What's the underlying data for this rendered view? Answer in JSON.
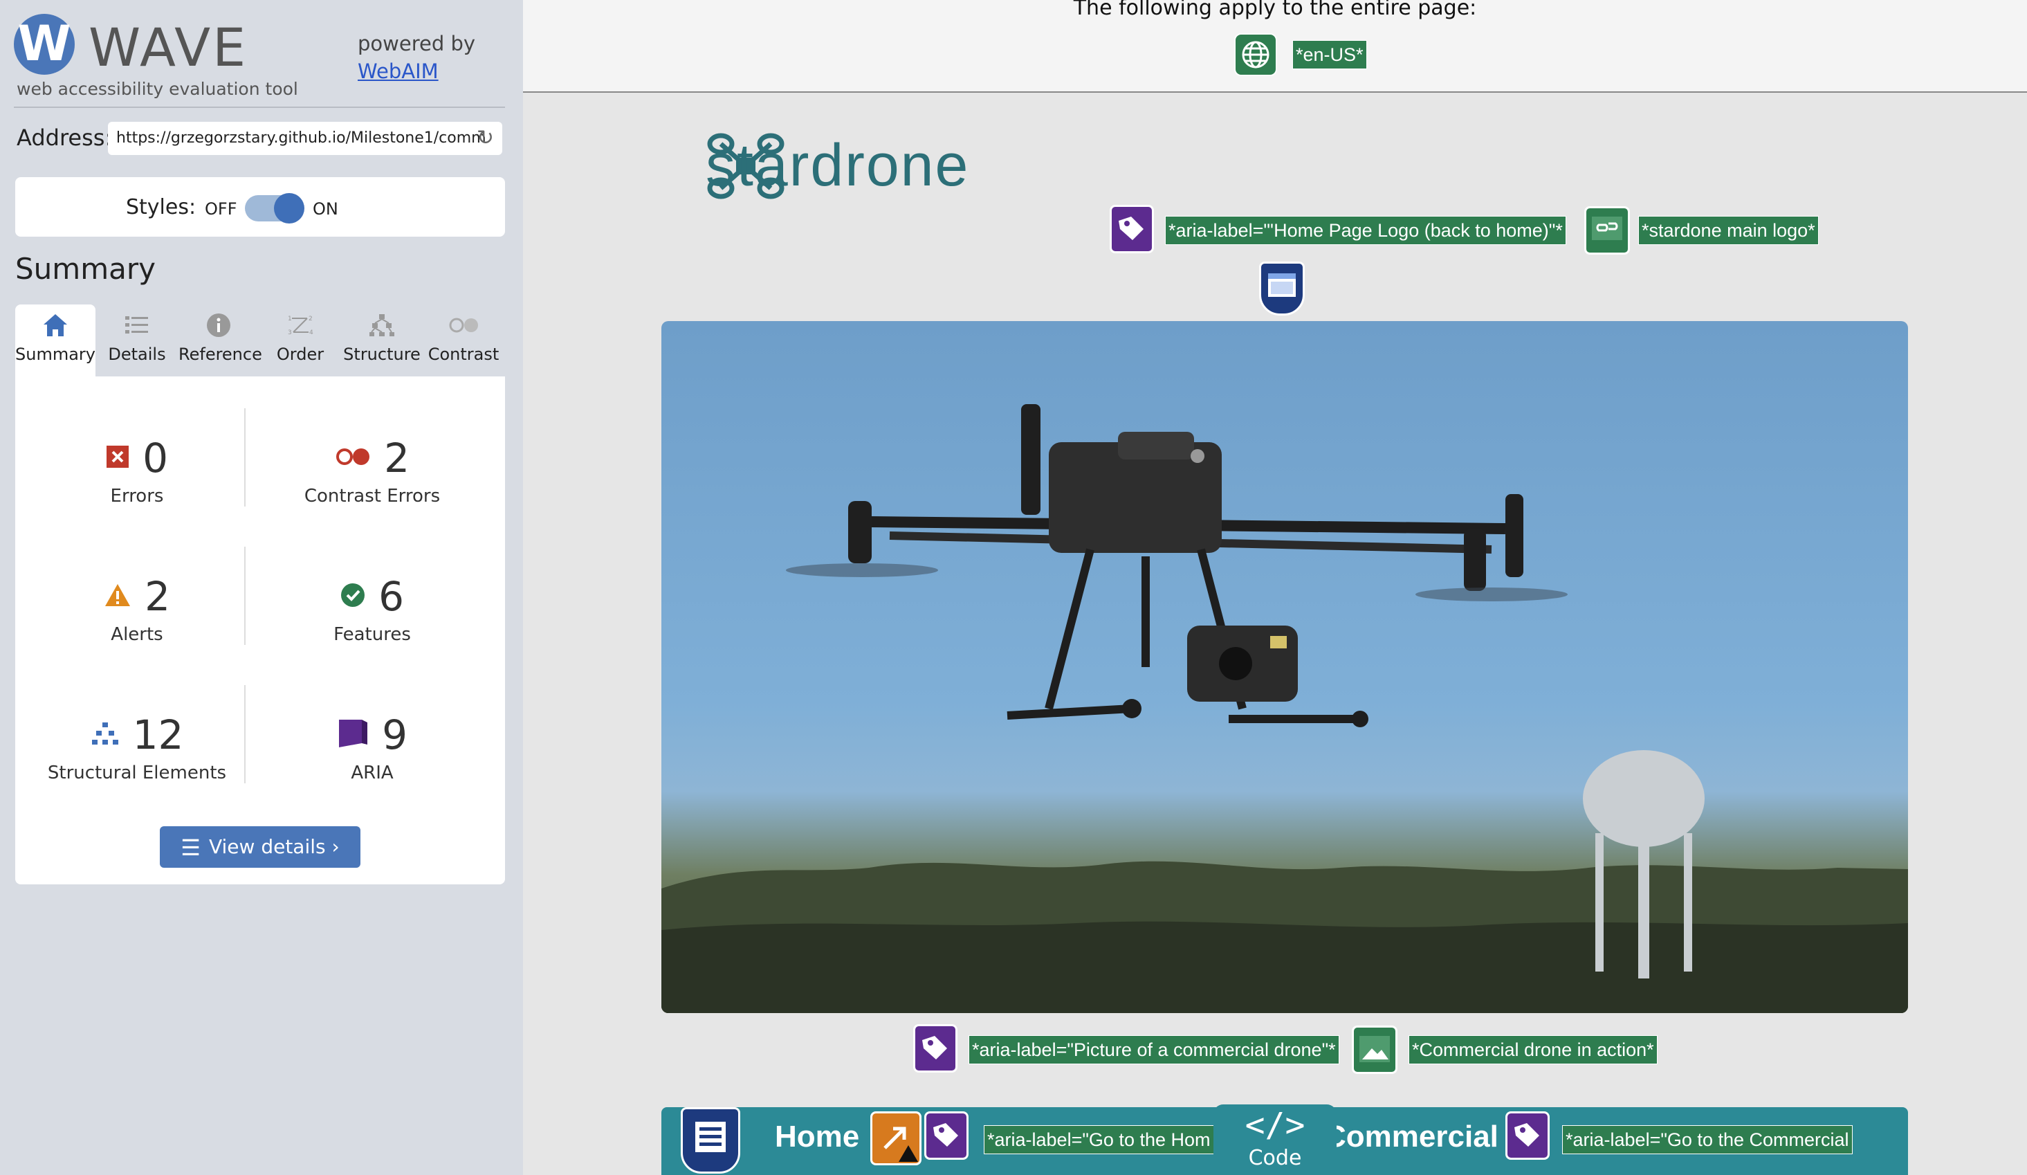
{
  "wave": {
    "logo_letter": "W",
    "title": "WAVE",
    "subtitle": "web accessibility evaluation tool",
    "powered_by": "powered by",
    "webaim_link": "WebAIM"
  },
  "address": {
    "label": "Address:",
    "value": "https://grzegorzstary.github.io/Milestone1/comm"
  },
  "styles": {
    "label": "Styles:",
    "off": "OFF",
    "on": "ON",
    "state": "on"
  },
  "summary_heading": "Summary",
  "tabs": [
    {
      "label": "Summary",
      "icon": "home-icon",
      "active": true
    },
    {
      "label": "Details",
      "icon": "list-icon"
    },
    {
      "label": "Reference",
      "icon": "info-icon"
    },
    {
      "label": "Order",
      "icon": "order-icon"
    },
    {
      "label": "Structure",
      "icon": "structure-icon"
    },
    {
      "label": "Contrast",
      "icon": "contrast-icon"
    }
  ],
  "stats": {
    "errors": {
      "count": "0",
      "label": "Errors"
    },
    "contrast": {
      "count": "2",
      "label": "Contrast Errors"
    },
    "alerts": {
      "count": "2",
      "label": "Alerts"
    },
    "features": {
      "count": "6",
      "label": "Features"
    },
    "structural": {
      "count": "12",
      "label": "Structural Elements"
    },
    "aria": {
      "count": "9",
      "label": "ARIA"
    }
  },
  "view_details": "View details ›",
  "page": {
    "apply_text": "The following apply to the entire page:",
    "lang_tag": "*en-US*",
    "brand_name": "stardrone",
    "logo_aria_tag": "*aria-label=\"'Home Page Logo (back to home)\"*",
    "logo_alt_tag": "*stardone main logo*",
    "hero_aria_tag": "*aria-label=\"Picture of a commercial drone\"*",
    "hero_alt_tag": "*Commercial drone in action*",
    "nav": {
      "home": "Home",
      "home_aria_tag": "*aria-label=\"Go to the Hom",
      "commercial": "Commercial",
      "commercial_aria_tag": "*aria-label=\"Go to the Commercial"
    },
    "code_tab": "Code",
    "code_symbol": "</>"
  },
  "colors": {
    "accent_blue": "#3f6fb8",
    "wave_green": "#2e7d4f",
    "aria_purple": "#5c2b8f",
    "error_red": "#c0392b",
    "alert_orange": "#e08a1e",
    "brand_teal": "#2c6f78"
  }
}
